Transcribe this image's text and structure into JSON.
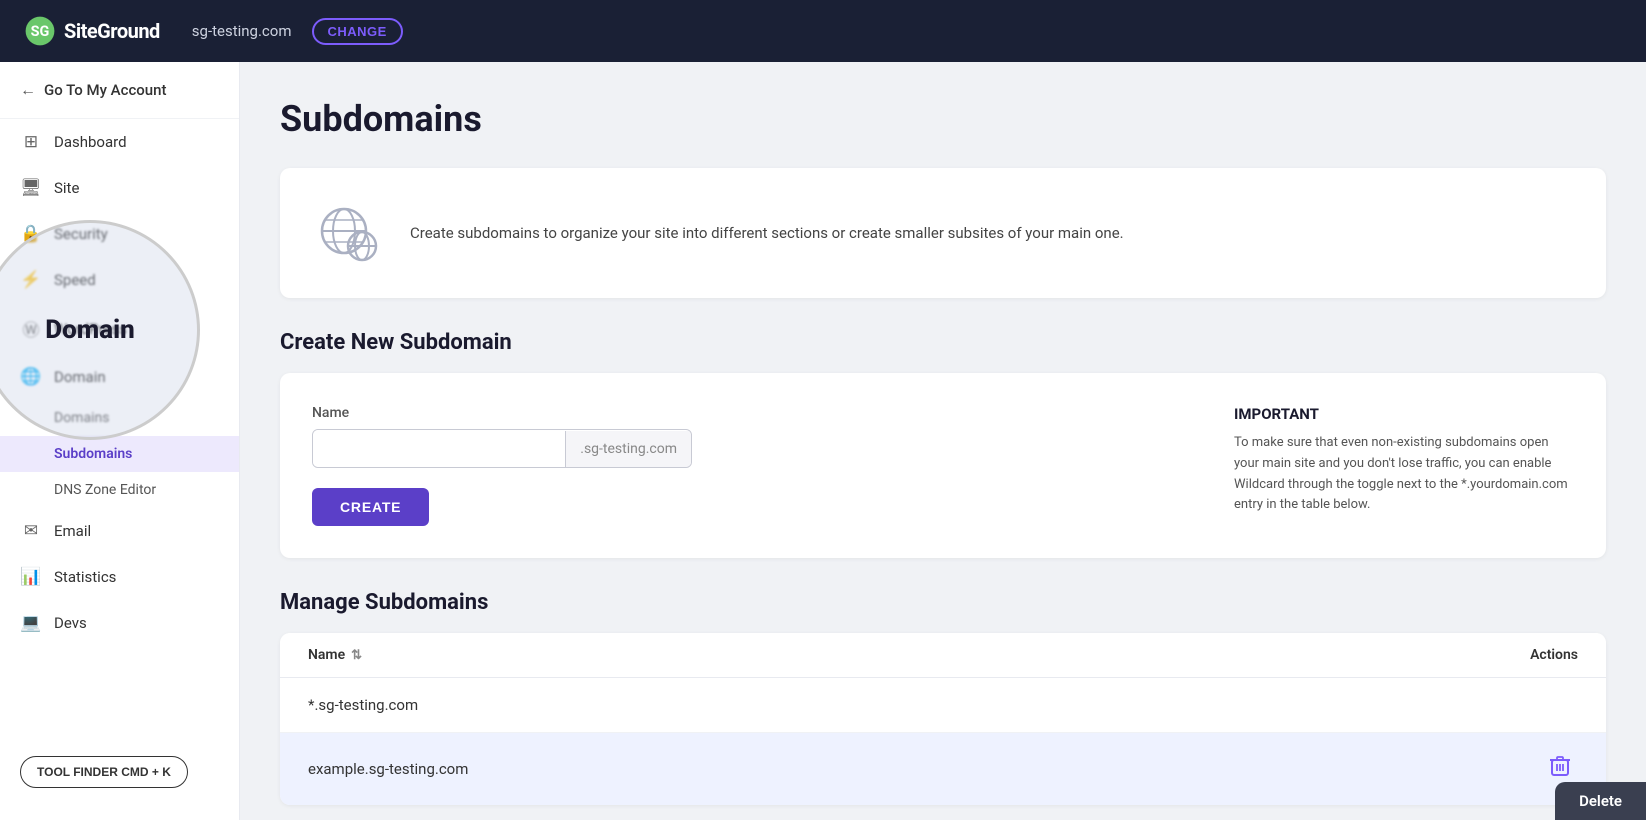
{
  "topnav": {
    "logo": "SiteGround",
    "domain": "sg-testing.com",
    "change_label": "CHANGE"
  },
  "sidebar": {
    "back_label": "Go To My Account",
    "items": [
      {
        "id": "dashboard",
        "label": "Dashboard",
        "icon": "⊞"
      },
      {
        "id": "site",
        "label": "Site",
        "icon": "🖥"
      },
      {
        "id": "security",
        "label": "Security",
        "icon": "🔒"
      },
      {
        "id": "speed",
        "label": "Speed",
        "icon": "⚡"
      },
      {
        "id": "wordpress",
        "label": "WordPress",
        "icon": "Ⓦ"
      },
      {
        "id": "domain",
        "label": "Domain",
        "icon": "🌐"
      }
    ],
    "domain_subitems": [
      {
        "id": "domains",
        "label": "Domains"
      },
      {
        "id": "subdomains",
        "label": "Subdomains"
      },
      {
        "id": "dns-zone-editor",
        "label": "DNS Zone Editor"
      }
    ],
    "bottom_items": [
      {
        "id": "email",
        "label": "Email",
        "icon": "✉"
      },
      {
        "id": "statistics",
        "label": "Statistics",
        "icon": "📊"
      },
      {
        "id": "devs",
        "label": "Devs",
        "icon": "💻"
      }
    ],
    "tool_finder_label": "TOOL FINDER CMD + K"
  },
  "main": {
    "page_title": "Subdomains",
    "info_card": {
      "text": "Create subdomains to organize your site into different sections or create smaller subsites of your main one."
    },
    "create_section": {
      "title": "Create New Subdomain",
      "form": {
        "name_label": "Name",
        "input_placeholder": "",
        "domain_suffix": ".sg-testing.com",
        "submit_label": "CREATE"
      },
      "important": {
        "title": "IMPORTANT",
        "text": "To make sure that even non-existing subdomains open your main site and you don't lose traffic, you can enable Wildcard through the toggle next to the *.yourdomain.com entry in the table below."
      }
    },
    "manage_section": {
      "title": "Manage Subdomains",
      "table": {
        "header_name": "Name",
        "header_actions": "Actions",
        "rows": [
          {
            "name": "*.sg-testing.com",
            "highlighted": false
          },
          {
            "name": "example.sg-testing.com",
            "highlighted": true
          }
        ]
      }
    }
  },
  "zoom_label": "Domain",
  "delete_tooltip": "Delete"
}
